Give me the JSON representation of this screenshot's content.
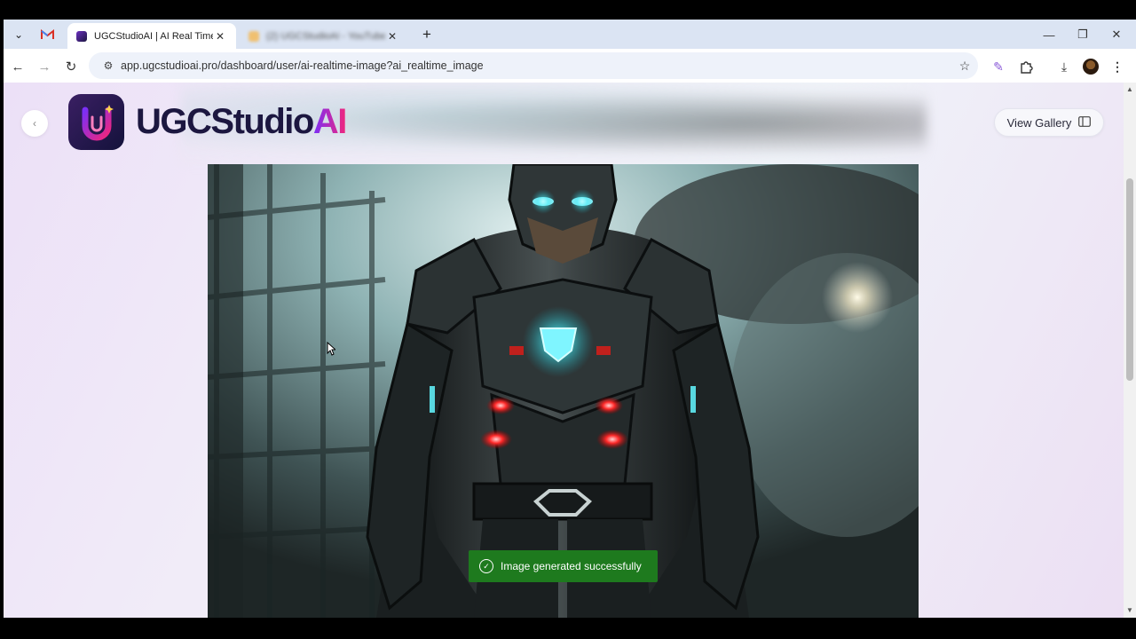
{
  "browser": {
    "tabs": [
      {
        "title": "UGCStudioAI | AI Real Time Ima",
        "active": true
      },
      {
        "title": "(2) UGCStudioAI - YouTube",
        "active": false,
        "blurred": true
      }
    ],
    "url": "app.ugcstudioai.pro/dashboard/user/ai-realtime-image?ai_realtime_image",
    "icons": {
      "tab_search": "chevron-down-icon",
      "gmail": "gmail-icon",
      "new_tab": "plus-icon",
      "back": "arrow-left-icon",
      "forward": "arrow-right-icon",
      "reload": "reload-icon",
      "site_info": "tune-icon",
      "bookmark": "star-icon",
      "extension_pen": "pen-icon",
      "extensions": "puzzle-icon",
      "downloads": "download-icon",
      "profile": "avatar-icon",
      "menu": "kebab-menu-icon"
    }
  },
  "header": {
    "brand_main": "UGCStudio",
    "brand_accent": "AI",
    "view_gallery_label": "View Gallery"
  },
  "toast": {
    "message": "Image generated successfully",
    "color": "#1e7a1e"
  },
  "colors": {
    "brand_dark": "#1c1740",
    "brand_gradient_start": "#7b2ff7",
    "brand_gradient_end": "#f1267b"
  }
}
